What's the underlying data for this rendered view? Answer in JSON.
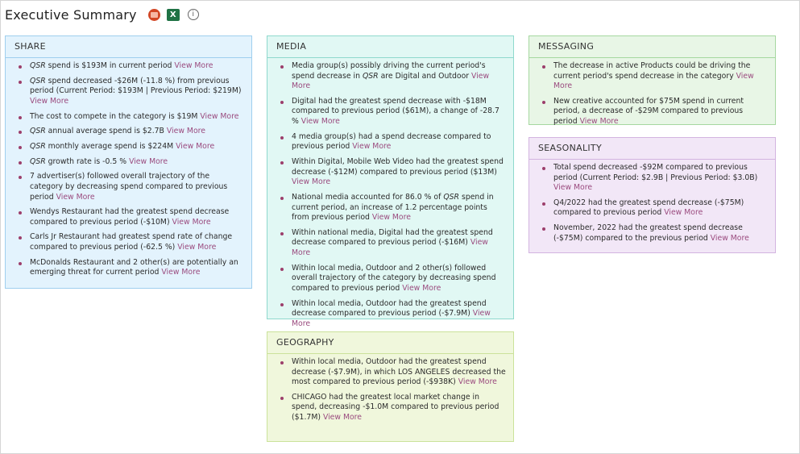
{
  "header": {
    "title": "Executive Summary",
    "info_glyph": "i",
    "excel_glyph": "X"
  },
  "share": {
    "title": "SHARE",
    "items": [
      {
        "em": "QSR",
        "text": " spend is $193M in current period ",
        "link": "View More"
      },
      {
        "em": "QSR",
        "text": " spend decreased -$26M (-11.8 %) from previous period (Current Period: $193M | Previous Period: $219M) ",
        "link": "View More"
      },
      {
        "em": "",
        "text": "The cost to compete in the category is $19M ",
        "link": "View More"
      },
      {
        "em": "QSR",
        "text": " annual average spend is $2.7B ",
        "link": "View More"
      },
      {
        "em": "QSR",
        "text": " monthly average spend is $224M ",
        "link": "View More"
      },
      {
        "em": "QSR",
        "text": " growth rate is -0.5 % ",
        "link": "View More"
      },
      {
        "em": "",
        "text": "7 advertiser(s) followed overall trajectory of the category by decreasing spend compared to previous period ",
        "link": "View More"
      },
      {
        "em": "",
        "text": "Wendys Restaurant had the greatest spend decrease compared to previous period (-$10M) ",
        "link": "View More"
      },
      {
        "em": "",
        "text": "Carls Jr Restaurant had greatest spend rate of change compared to previous period (-62.5 %) ",
        "link": "View More"
      },
      {
        "em": "",
        "text": "McDonalds Restaurant and 2 other(s) are potentially an emerging threat for current period ",
        "link": "View More"
      }
    ]
  },
  "media": {
    "title": "MEDIA",
    "items": [
      {
        "pre": "Media group(s) possibly driving the current period's spend decrease in ",
        "em": "QSR",
        "text": " are Digital and Outdoor ",
        "link": "View More"
      },
      {
        "pre": "",
        "em": "",
        "text": "Digital had the greatest spend decrease with -$18M compared to previous period ($61M), a change of -28.7 % ",
        "link": "View More"
      },
      {
        "pre": "",
        "em": "",
        "text": "4 media group(s) had a spend decrease compared to previous period ",
        "link": "View More"
      },
      {
        "pre": "",
        "em": "",
        "text": "Within Digital, Mobile Web Video had the greatest spend decrease (-$12M) compared to previous period ($13M) ",
        "link": "View More"
      },
      {
        "pre": "National media accounted for 86.0 % of ",
        "em": "QSR",
        "text": " spend in current period, an increase of 1.2 percentage points from previous period ",
        "link": "View More"
      },
      {
        "pre": "",
        "em": "",
        "text": "Within national media, Digital had the greatest spend decrease compared to previous period (-$16M) ",
        "link": "View More"
      },
      {
        "pre": "",
        "em": "",
        "text": "Within local media, Outdoor and 2 other(s) followed overall trajectory of the category by decreasing spend compared to previous period ",
        "link": "View More"
      },
      {
        "pre": "",
        "em": "",
        "text": "Within local media, Outdoor had the greatest spend decrease compared to previous period (-$7.9M) ",
        "link": "View More"
      }
    ]
  },
  "messaging": {
    "title": "MESSAGING",
    "items": [
      {
        "text": "The decrease in active Products could be driving the current period's spend decrease in the category ",
        "link": "View More"
      },
      {
        "text": "New creative accounted for $75M spend in current period, a decrease of -$29M compared to previous period ",
        "link": "View More"
      }
    ]
  },
  "seasonality": {
    "title": "SEASONALITY",
    "items": [
      {
        "text": "Total spend decreased -$92M compared to previous period (Current Period: $2.9B | Previous Period: $3.0B) ",
        "link": "View More"
      },
      {
        "text": "Q4/2022 had the greatest spend decrease (-$75M) compared to previous period ",
        "link": "View More"
      },
      {
        "text": "November, 2022 had the greatest spend decrease (-$75M) compared to the previous period ",
        "link": "View More"
      }
    ]
  },
  "geography": {
    "title": "GEOGRAPHY",
    "items": [
      {
        "text": "Within local media, Outdoor had the greatest spend decrease (-$7.9M), in which LOS ANGELES decreased the most compared to previous period (-$938K) ",
        "link": "View More"
      },
      {
        "text": "CHICAGO had the greatest local market change in spend, decreasing -$1.0M compared to previous period ($1.7M) ",
        "link": "View More"
      }
    ]
  },
  "colors": {
    "link": "#9a4a7e",
    "bullet": "#9c3e6b",
    "share_bg": "#e3f3fd",
    "media_bg": "#e1f8f4",
    "messaging_bg": "#e8f6e6",
    "seasonality_bg": "#f2e7f7",
    "geography_bg": "#f0f7dc"
  }
}
